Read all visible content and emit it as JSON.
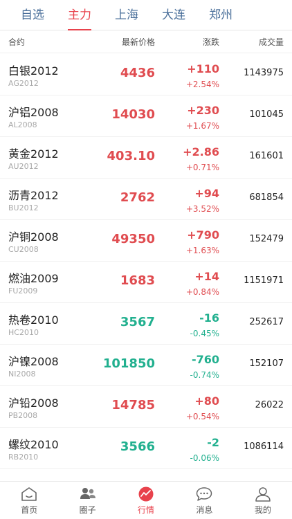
{
  "tabs": [
    {
      "label": "自选"
    },
    {
      "label": "主力",
      "active": true
    },
    {
      "label": "上海"
    },
    {
      "label": "大连"
    },
    {
      "label": "郑州"
    }
  ],
  "table": {
    "headers": {
      "contract": "合约",
      "price": "最新价格",
      "change": "涨跌",
      "volume": "成交量"
    },
    "rows": [
      {
        "name": "白银2012",
        "code": "AG2012",
        "price": "4436",
        "change": "+110",
        "pct": "+2.54%",
        "volume": "1143975",
        "trend": "up"
      },
      {
        "name": "沪铝2008",
        "code": "AL2008",
        "price": "14030",
        "change": "+230",
        "pct": "+1.67%",
        "volume": "101045",
        "trend": "up"
      },
      {
        "name": "黄金2012",
        "code": "AU2012",
        "price": "403.10",
        "change": "+2.86",
        "pct": "+0.71%",
        "volume": "161601",
        "trend": "up"
      },
      {
        "name": "沥青2012",
        "code": "BU2012",
        "price": "2762",
        "change": "+94",
        "pct": "+3.52%",
        "volume": "681854",
        "trend": "up"
      },
      {
        "name": "沪铜2008",
        "code": "CU2008",
        "price": "49350",
        "change": "+790",
        "pct": "+1.63%",
        "volume": "152479",
        "trend": "up"
      },
      {
        "name": "燃油2009",
        "code": "FU2009",
        "price": "1683",
        "change": "+14",
        "pct": "+0.84%",
        "volume": "1151971",
        "trend": "up"
      },
      {
        "name": "热卷2010",
        "code": "HC2010",
        "price": "3567",
        "change": "-16",
        "pct": "-0.45%",
        "volume": "252617",
        "trend": "down"
      },
      {
        "name": "沪镍2008",
        "code": "NI2008",
        "price": "101850",
        "change": "-760",
        "pct": "-0.74%",
        "volume": "152107",
        "trend": "down"
      },
      {
        "name": "沪铅2008",
        "code": "PB2008",
        "price": "14785",
        "change": "+80",
        "pct": "+0.54%",
        "volume": "26022",
        "trend": "up"
      },
      {
        "name": "螺纹2010",
        "code": "RB2010",
        "price": "3566",
        "change": "-2",
        "pct": "-0.06%",
        "volume": "1086114",
        "trend": "down"
      }
    ]
  },
  "colors": {
    "up": "#e04c50",
    "down": "#22b08f",
    "accent": "#e8424c",
    "tab": "#4a6f9a"
  },
  "bottom_nav": [
    {
      "label": "首页",
      "icon": "home-icon"
    },
    {
      "label": "圈子",
      "icon": "people-icon"
    },
    {
      "label": "行情",
      "icon": "market-chart-icon",
      "active": true
    },
    {
      "label": "消息",
      "icon": "message-icon"
    },
    {
      "label": "我的",
      "icon": "profile-icon"
    }
  ]
}
